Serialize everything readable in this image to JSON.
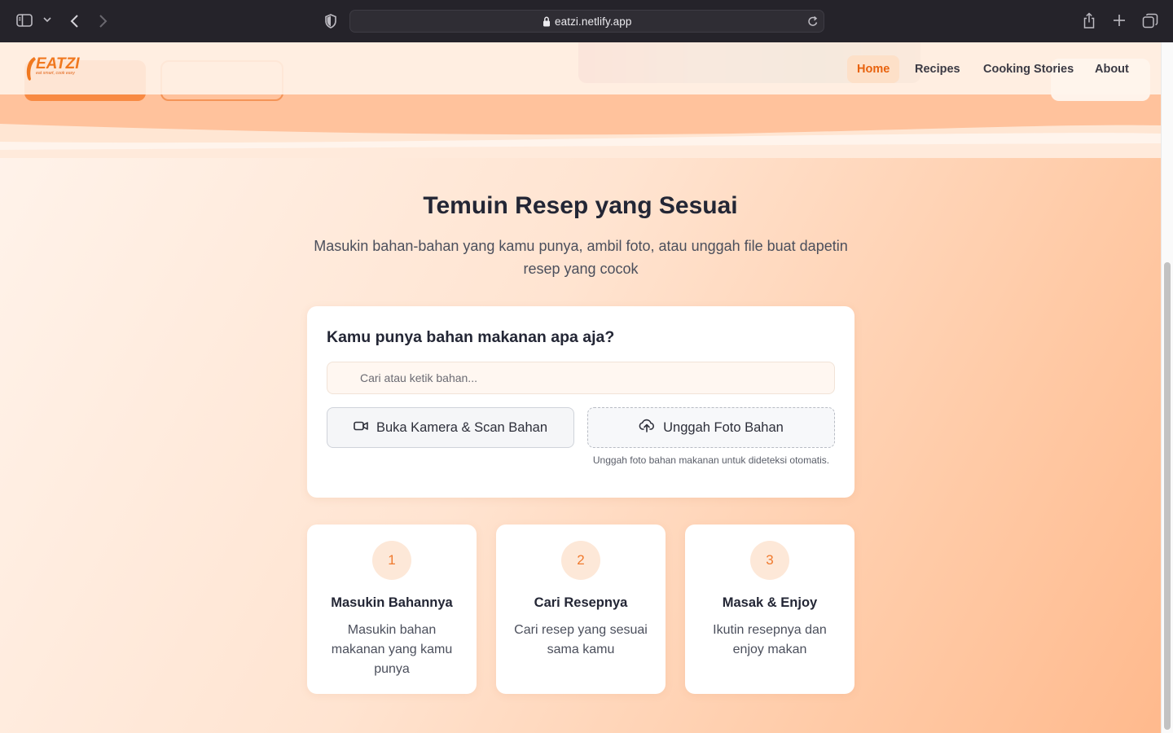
{
  "browser": {
    "url": "eatzi.netlify.app",
    "icons": [
      "sidebar-icon",
      "chevron-down-icon",
      "back-icon",
      "forward-icon",
      "shield-icon",
      "lock-icon",
      "reload-icon",
      "share-icon",
      "plus-icon",
      "tabs-icon"
    ]
  },
  "brand": {
    "logo_text": "EATZI",
    "tagline": "eat smart, cook easy",
    "accent": "#f0781f"
  },
  "nav": {
    "items": [
      {
        "label": "Home",
        "active": true
      },
      {
        "label": "Recipes",
        "active": false
      },
      {
        "label": "Cooking Stories",
        "active": false
      },
      {
        "label": "About",
        "active": false
      }
    ]
  },
  "hero": {
    "title": "Temuin Resep yang Sesuai",
    "subtitle": "Masukin bahan-bahan yang kamu punya, ambil foto, atau unggah file buat dapetin resep yang cocok"
  },
  "search_card": {
    "heading": "Kamu punya bahan makanan apa aja?",
    "input_placeholder": "Cari atau ketik bahan...",
    "input_value": "",
    "camera_button": "Buka Kamera & Scan Bahan",
    "upload_button": "Unggah Foto Bahan",
    "upload_note": "Unggah foto bahan makanan untuk dideteksi otomatis."
  },
  "steps": [
    {
      "number": "1",
      "title": "Masukin Bahannya",
      "description": "Masukin bahan makanan yang kamu punya"
    },
    {
      "number": "2",
      "title": "Cari Resepnya",
      "description": "Cari resep yang sesuai sama kamu"
    },
    {
      "number": "3",
      "title": "Masak & Enjoy",
      "description": "Ikutin resepnya dan enjoy makan"
    }
  ]
}
